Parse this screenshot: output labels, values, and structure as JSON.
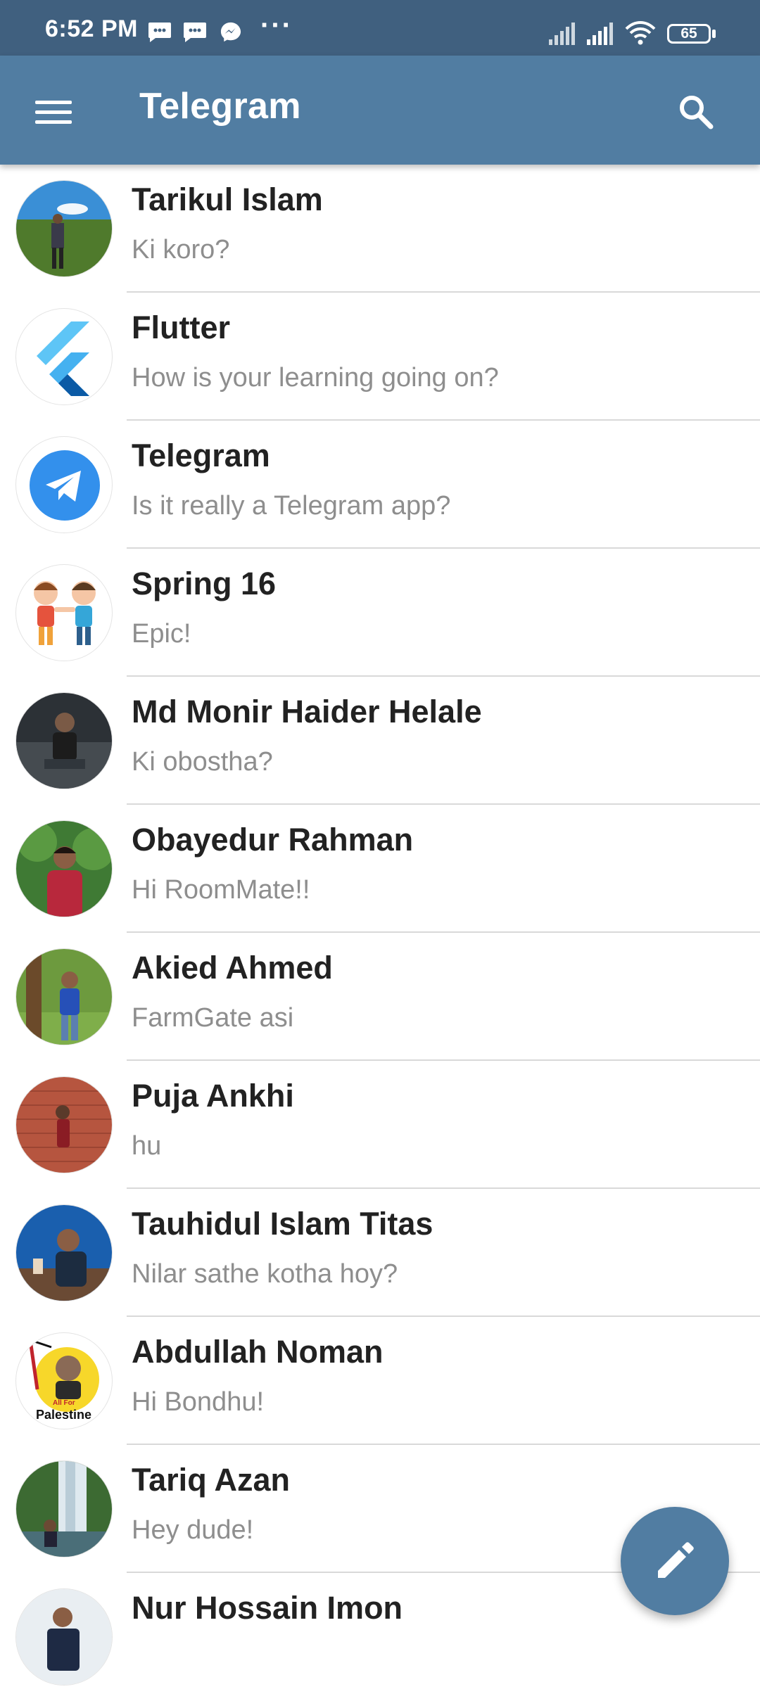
{
  "status_bar": {
    "time": "6:52 PM",
    "notifications": [
      "message-icon",
      "message-icon",
      "messenger-icon"
    ],
    "more": "···",
    "battery": "65"
  },
  "app_bar": {
    "title": "Telegram",
    "menu_icon": "hamburger-menu-icon",
    "search_icon": "search-icon"
  },
  "chats": [
    {
      "name": "Tarikul Islam",
      "message": "Ki koro?"
    },
    {
      "name": "Flutter",
      "message": "How is your learning going on?"
    },
    {
      "name": "Telegram",
      "message": "Is it really a Telegram app?"
    },
    {
      "name": "Spring 16",
      "message": "Epic!"
    },
    {
      "name": "Md Monir Haider Helale",
      "message": "Ki obostha?"
    },
    {
      "name": "Obayedur Rahman",
      "message": "Hi RoomMate!!"
    },
    {
      "name": "Akied Ahmed",
      "message": "FarmGate asi"
    },
    {
      "name": "Puja Ankhi",
      "message": "hu"
    },
    {
      "name": "Tauhidul Islam Titas",
      "message": "Nilar sathe kotha hoy?"
    },
    {
      "name": "Abdullah Noman",
      "message": "Hi Bondhu!",
      "avatar_text": [
        "All For",
        "Palestine"
      ]
    },
    {
      "name": "Tariq Azan",
      "message": "Hey dude!"
    },
    {
      "name": "Nur Hossain Imon",
      "message": ""
    }
  ],
  "fab": {
    "icon": "pencil-icon"
  },
  "colors": {
    "status_bar": "#40607f",
    "app_bar": "#517da2",
    "fab": "#517da2",
    "name_text": "#222222",
    "message_text": "#8e8e8e"
  }
}
